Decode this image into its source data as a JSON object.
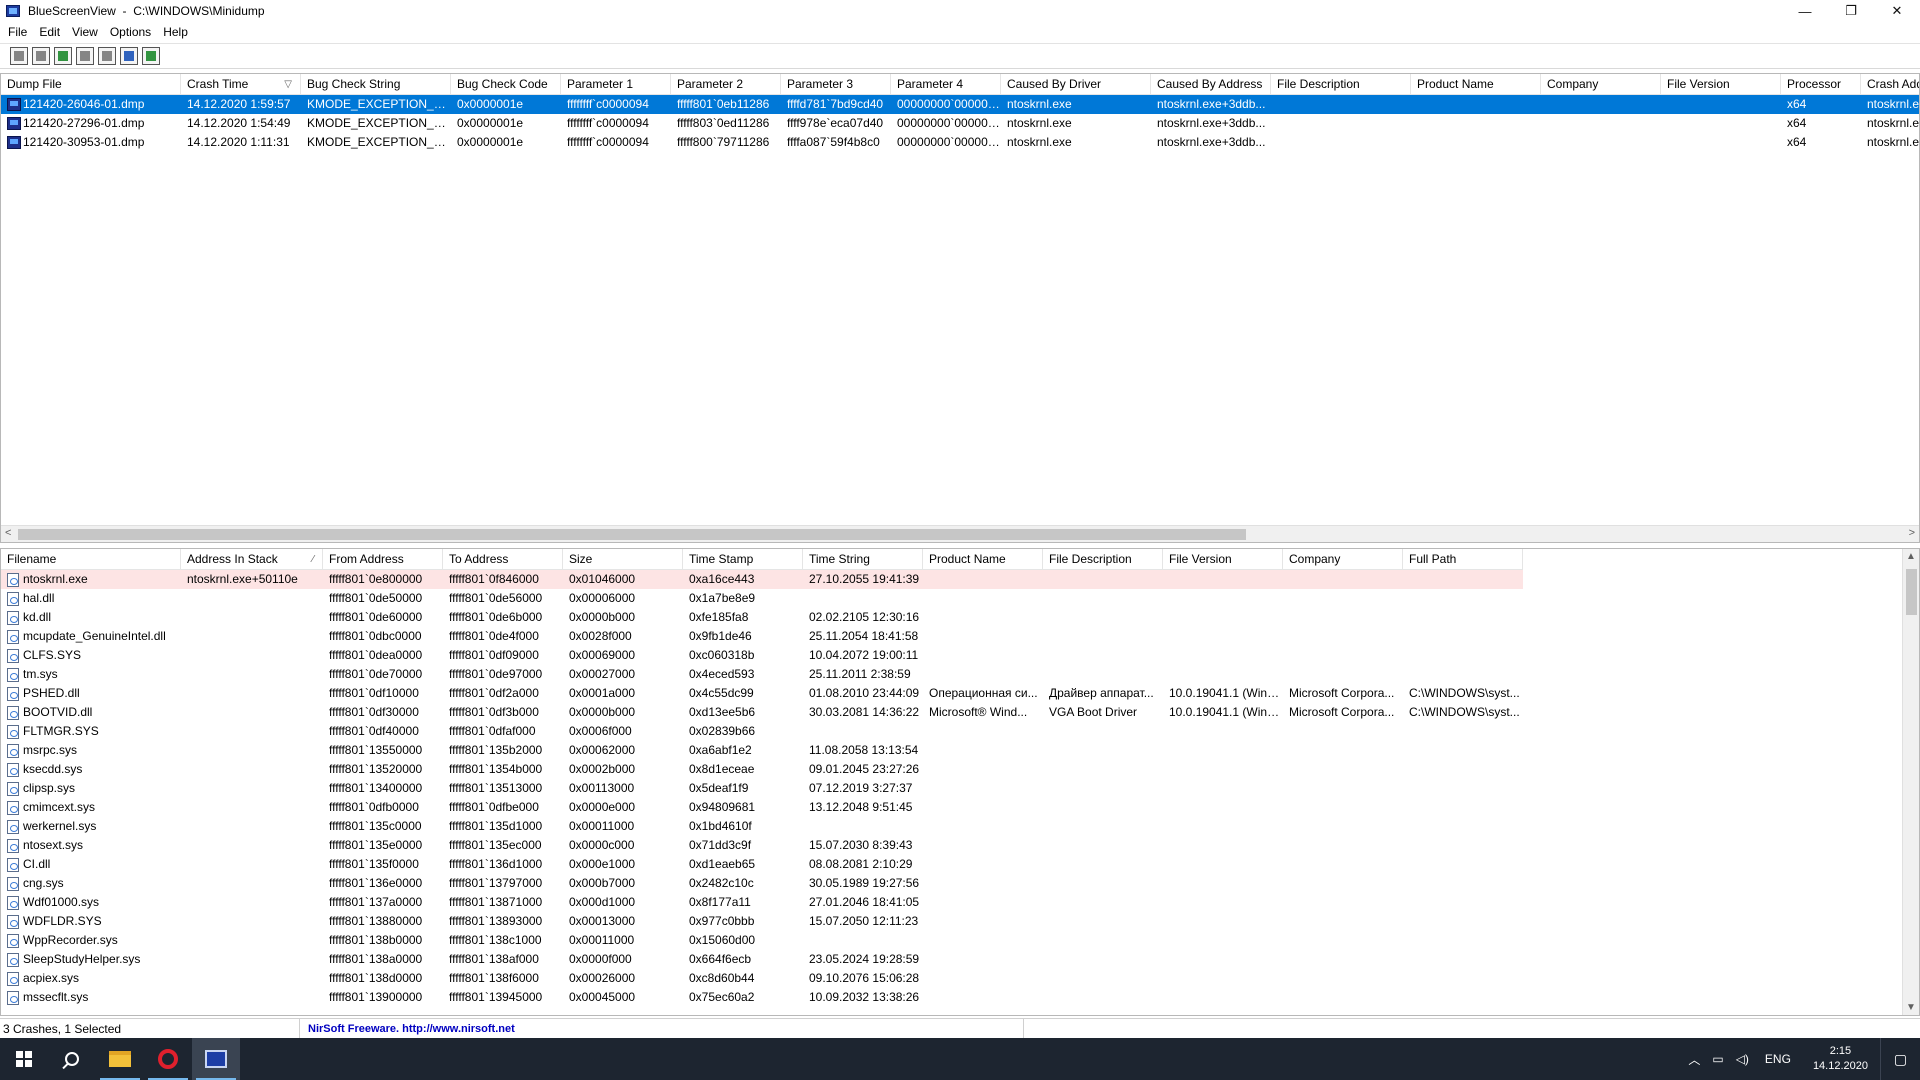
{
  "window": {
    "app_name": "BlueScreenView",
    "path": "C:\\WINDOWS\\Minidump",
    "controls": {
      "minimize": "—",
      "restore": "❐",
      "close": "✕"
    }
  },
  "menu": [
    "File",
    "Edit",
    "View",
    "Options",
    "Help"
  ],
  "toolbar_icons": [
    "properties-icon",
    "save-icon",
    "refresh-icon",
    "copy-icon",
    "html-report-icon",
    "find-icon",
    "exit-icon"
  ],
  "crash_list": {
    "columns": [
      "Dump File",
      "Crash Time",
      "Bug Check String",
      "Bug Check Code",
      "Parameter 1",
      "Parameter 2",
      "Parameter 3",
      "Parameter 4",
      "Caused By Driver",
      "Caused By Address",
      "File Description",
      "Product Name",
      "Company",
      "File Version",
      "Processor",
      "Crash Address"
    ],
    "sort_column": 1,
    "rows": [
      [
        "121420-26046-01.dmp",
        "14.12.2020 1:59:57",
        "KMODE_EXCEPTION_N...",
        "0x0000001e",
        "ffffffff`c0000094",
        "fffff801`0eb11286",
        "ffffd781`7bd9cd40",
        "00000000`000000...",
        "ntoskrnl.exe",
        "ntoskrnl.exe+3ddb...",
        "",
        "",
        "",
        "",
        "x64",
        "ntoskrnl.e"
      ],
      [
        "121420-27296-01.dmp",
        "14.12.2020 1:54:49",
        "KMODE_EXCEPTION_N...",
        "0x0000001e",
        "ffffffff`c0000094",
        "fffff803`0ed11286",
        "ffff978e`eca07d40",
        "00000000`000000...",
        "ntoskrnl.exe",
        "ntoskrnl.exe+3ddb...",
        "",
        "",
        "",
        "",
        "x64",
        "ntoskrnl.e"
      ],
      [
        "121420-30953-01.dmp",
        "14.12.2020 1:11:31",
        "KMODE_EXCEPTION_N...",
        "0x0000001e",
        "ffffffff`c0000094",
        "fffff800`79711286",
        "ffffa087`59f4b8c0",
        "00000000`000000...",
        "ntoskrnl.exe",
        "ntoskrnl.exe+3ddb...",
        "",
        "",
        "",
        "",
        "x64",
        "ntoskrnl.e"
      ]
    ],
    "selected_row": 0
  },
  "driver_list": {
    "columns": [
      "Filename",
      "Address In Stack",
      "From Address",
      "To Address",
      "Size",
      "Time Stamp",
      "Time String",
      "Product Name",
      "File Description",
      "File Version",
      "Company",
      "Full Path"
    ],
    "sort_column": 1,
    "rows": [
      [
        "ntoskrnl.exe",
        "ntoskrnl.exe+50110e",
        "fffff801`0e800000",
        "fffff801`0f846000",
        "0x01046000",
        "0xa16ce443",
        "27.10.2055 19:41:39",
        "",
        "",
        "",
        "",
        ""
      ],
      [
        "hal.dll",
        "",
        "fffff801`0de50000",
        "fffff801`0de56000",
        "0x00006000",
        "0x1a7be8e9",
        "",
        "",
        "",
        "",
        "",
        ""
      ],
      [
        "kd.dll",
        "",
        "fffff801`0de60000",
        "fffff801`0de6b000",
        "0x0000b000",
        "0xfe185fa8",
        "02.02.2105 12:30:16",
        "",
        "",
        "",
        "",
        ""
      ],
      [
        "mcupdate_GenuineIntel.dll",
        "",
        "fffff801`0dbc0000",
        "fffff801`0de4f000",
        "0x0028f000",
        "0x9fb1de46",
        "25.11.2054 18:41:58",
        "",
        "",
        "",
        "",
        ""
      ],
      [
        "CLFS.SYS",
        "",
        "fffff801`0dea0000",
        "fffff801`0df09000",
        "0x00069000",
        "0xc060318b",
        "10.04.2072 19:00:11",
        "",
        "",
        "",
        "",
        ""
      ],
      [
        "tm.sys",
        "",
        "fffff801`0de70000",
        "fffff801`0de97000",
        "0x00027000",
        "0x4eced593",
        "25.11.2011 2:38:59",
        "",
        "",
        "",
        "",
        ""
      ],
      [
        "PSHED.dll",
        "",
        "fffff801`0df10000",
        "fffff801`0df2a000",
        "0x0001a000",
        "0x4c55dc99",
        "01.08.2010 23:44:09",
        "Операционная си...",
        "Драйвер аппарат...",
        "10.0.19041.1 (WinB...",
        "Microsoft Corpora...",
        "C:\\WINDOWS\\syst..."
      ],
      [
        "BOOTVID.dll",
        "",
        "fffff801`0df30000",
        "fffff801`0df3b000",
        "0x0000b000",
        "0xd13ee5b6",
        "30.03.2081 14:36:22",
        "Microsoft® Wind...",
        "VGA Boot Driver",
        "10.0.19041.1 (WinB...",
        "Microsoft Corpora...",
        "C:\\WINDOWS\\syst..."
      ],
      [
        "FLTMGR.SYS",
        "",
        "fffff801`0df40000",
        "fffff801`0dfaf000",
        "0x0006f000",
        "0x02839b66",
        "",
        "",
        "",
        "",
        "",
        ""
      ],
      [
        "msrpc.sys",
        "",
        "fffff801`13550000",
        "fffff801`135b2000",
        "0x00062000",
        "0xa6abf1e2",
        "11.08.2058 13:13:54",
        "",
        "",
        "",
        "",
        ""
      ],
      [
        "ksecdd.sys",
        "",
        "fffff801`13520000",
        "fffff801`1354b000",
        "0x0002b000",
        "0x8d1eceae",
        "09.01.2045 23:27:26",
        "",
        "",
        "",
        "",
        ""
      ],
      [
        "clipsp.sys",
        "",
        "fffff801`13400000",
        "fffff801`13513000",
        "0x00113000",
        "0x5deaf1f9",
        "07.12.2019 3:27:37",
        "",
        "",
        "",
        "",
        ""
      ],
      [
        "cmimcext.sys",
        "",
        "fffff801`0dfb0000",
        "fffff801`0dfbe000",
        "0x0000e000",
        "0x94809681",
        "13.12.2048 9:51:45",
        "",
        "",
        "",
        "",
        ""
      ],
      [
        "werkernel.sys",
        "",
        "fffff801`135c0000",
        "fffff801`135d1000",
        "0x00011000",
        "0x1bd4610f",
        "",
        "",
        "",
        "",
        "",
        ""
      ],
      [
        "ntosext.sys",
        "",
        "fffff801`135e0000",
        "fffff801`135ec000",
        "0x0000c000",
        "0x71dd3c9f",
        "15.07.2030 8:39:43",
        "",
        "",
        "",
        "",
        ""
      ],
      [
        "CI.dll",
        "",
        "fffff801`135f0000",
        "fffff801`136d1000",
        "0x000e1000",
        "0xd1eaeb65",
        "08.08.2081 2:10:29",
        "",
        "",
        "",
        "",
        ""
      ],
      [
        "cng.sys",
        "",
        "fffff801`136e0000",
        "fffff801`13797000",
        "0x000b7000",
        "0x2482c10c",
        "30.05.1989 19:27:56",
        "",
        "",
        "",
        "",
        ""
      ],
      [
        "Wdf01000.sys",
        "",
        "fffff801`137a0000",
        "fffff801`13871000",
        "0x000d1000",
        "0x8f177a11",
        "27.01.2046 18:41:05",
        "",
        "",
        "",
        "",
        ""
      ],
      [
        "WDFLDR.SYS",
        "",
        "fffff801`13880000",
        "fffff801`13893000",
        "0x00013000",
        "0x977c0bbb",
        "15.07.2050 12:11:23",
        "",
        "",
        "",
        "",
        ""
      ],
      [
        "WppRecorder.sys",
        "",
        "fffff801`138b0000",
        "fffff801`138c1000",
        "0x00011000",
        "0x15060d00",
        "",
        "",
        "",
        "",
        "",
        ""
      ],
      [
        "SleepStudyHelper.sys",
        "",
        "fffff801`138a0000",
        "fffff801`138af000",
        "0x0000f000",
        "0x664f6ecb",
        "23.05.2024 19:28:59",
        "",
        "",
        "",
        "",
        ""
      ],
      [
        "acpiex.sys",
        "",
        "fffff801`138d0000",
        "fffff801`138f6000",
        "0x00026000",
        "0xc8d60b44",
        "09.10.2076 15:06:28",
        "",
        "",
        "",
        "",
        ""
      ],
      [
        "mssecflt.sys",
        "",
        "fffff801`13900000",
        "fffff801`13945000",
        "0x00045000",
        "0x75ec60a2",
        "10.09.2032 13:38:26",
        "",
        "",
        "",
        "",
        ""
      ]
    ],
    "highlighted_row": 0
  },
  "status": {
    "summary": "3 Crashes, 1 Selected",
    "credit": "NirSoft Freeware.  http://www.nirsoft.net"
  },
  "taskbar": {
    "apps": [
      "windows-start",
      "search",
      "file-explorer",
      "opera-browser",
      "bluescreenview"
    ],
    "language": "ENG",
    "time": "2:15",
    "date": "14.12.2020"
  }
}
